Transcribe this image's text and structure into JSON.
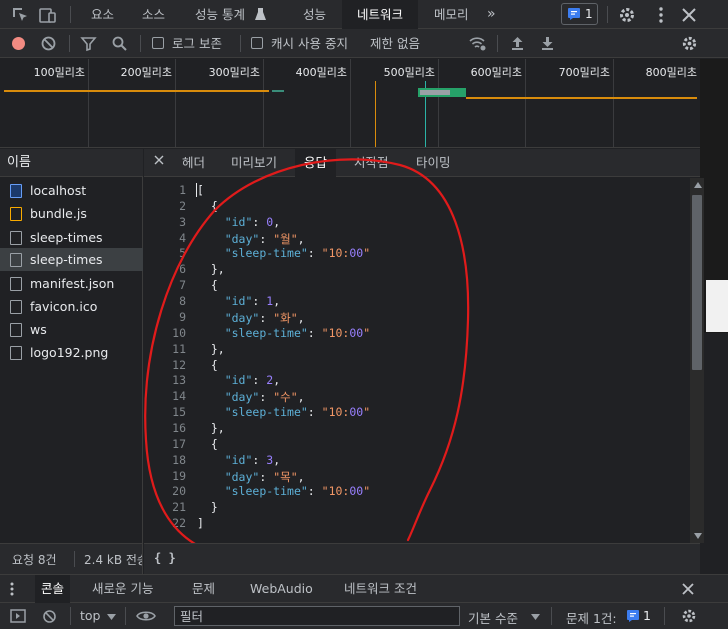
{
  "top_tabs": [
    "요소",
    "소스",
    "성능 통계",
    "성능",
    "네트워크",
    "메모리"
  ],
  "active_top_tab": "네트워크",
  "issues_badge": "1",
  "toolbar": {
    "preserve_log": "로그 보존",
    "disable_cache": "캐시 사용 중지",
    "throttle": "제한 없음"
  },
  "timeline_ticks": [
    "100밀리초",
    "200밀리초",
    "300밀리초",
    "400밀리초",
    "500밀리초",
    "600밀리초",
    "700밀리초",
    "800밀리초"
  ],
  "name_header": "이름",
  "files": [
    "localhost",
    "bundle.js",
    "sleep-times",
    "sleep-times",
    "manifest.json",
    "favicon.ico",
    "ws",
    "logo192.png"
  ],
  "status": {
    "requests": "요청 8건",
    "transferred": "2.4 kB 전송"
  },
  "detail_tabs": [
    "헤더",
    "미리보기",
    "응답",
    "시작점",
    "타이밍"
  ],
  "active_detail_tab": "응답",
  "response_lines": [
    "[",
    "  {",
    "    \"id\": 0,",
    "    \"day\": \"월\",",
    "    \"sleep-time\": \"10:00\"",
    "  },",
    "  {",
    "    \"id\": 1,",
    "    \"day\": \"화\",",
    "    \"sleep-time\": \"10:00\"",
    "  },",
    "  {",
    "    \"id\": 2,",
    "    \"day\": \"수\",",
    "    \"sleep-time\": \"10:00\"",
    "  },",
    "  {",
    "    \"id\": 3,",
    "    \"day\": \"목\",",
    "    \"sleep-time\": \"10:00\"",
    "  }",
    "]"
  ],
  "pretty_print": "{ }",
  "drawer_tabs": [
    "콘솔",
    "새로운 기능",
    "문제",
    "WebAudio",
    "네트워크 조건"
  ],
  "active_drawer_tab": "콘솔",
  "console": {
    "context": "top",
    "filter_placeholder": "필터",
    "level": "기본 수준",
    "issues_label": "문제 1건:",
    "issues_count": "1"
  },
  "colors": {
    "accent": "#8ab4f8",
    "record": "#f28b82",
    "annotation": "#e01b1b",
    "key": "#5db0d7",
    "string": "#f29766",
    "number": "#9980ff"
  }
}
